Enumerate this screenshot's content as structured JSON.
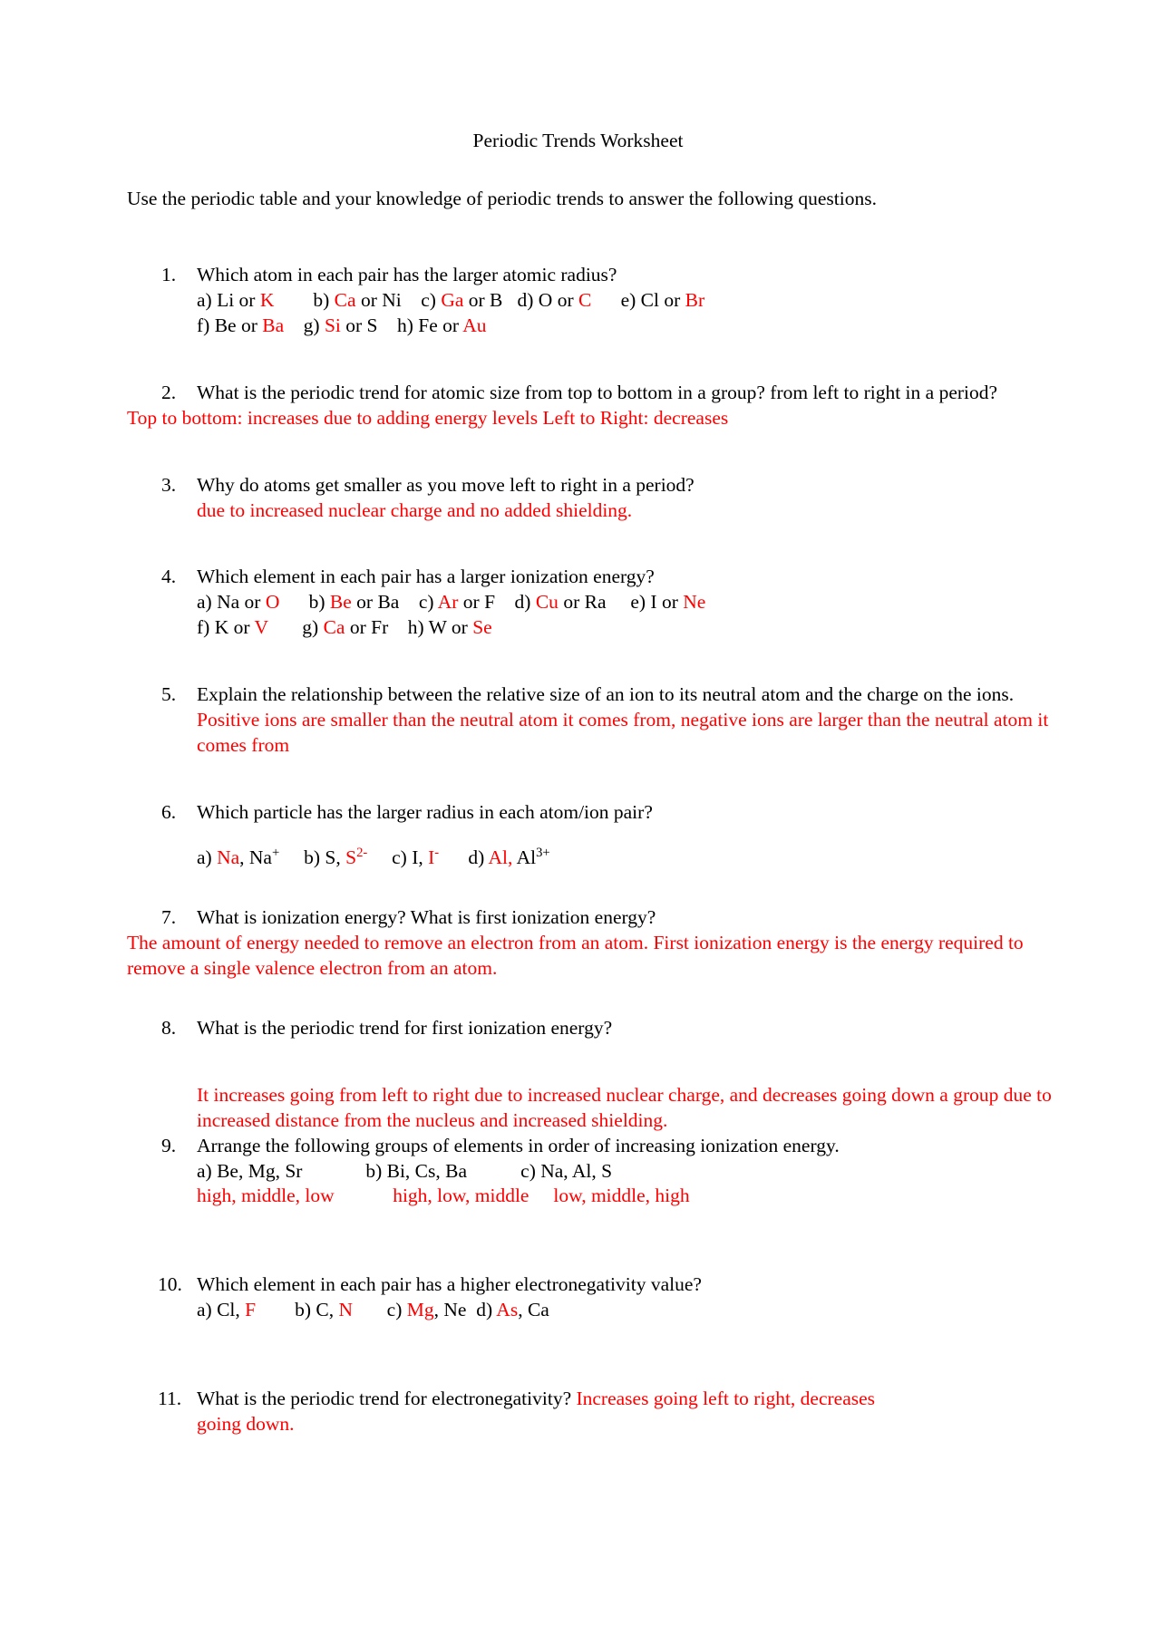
{
  "document": {
    "title": "Periodic Trends Worksheet",
    "intro": "Use the periodic table and your knowledge of periodic trends to answer the following questions."
  },
  "questions": [
    {
      "number": "1.",
      "text": "Which atom in each pair has the larger atomic radius?",
      "options_line_1": {
        "a_label": "a) Li or ",
        "a_answer": "K",
        "b_label": "b) ",
        "b_answer": "Ca",
        "b_rest": " or Ni",
        "c_label": "c) ",
        "c_answer": "Ga",
        "c_rest": " or B",
        "d_label": "d) O or ",
        "d_answer": "C",
        "e_label": "e) Cl or ",
        "e_answer": "Br"
      },
      "options_line_2": {
        "f_label": "f) Be or ",
        "f_answer": "Ba",
        "g_label": "g) ",
        "g_answer": "Si",
        "g_rest": " or S",
        "h_label": "h) Fe or ",
        "h_answer": "Au"
      }
    },
    {
      "number": "2.",
      "text": "What is the periodic trend for atomic size from top to bottom in a group? from left to right in a period?",
      "answer": "Top to bottom: increases due to adding energy levels   Left to Right: decreases"
    },
    {
      "number": "3.",
      "text": "Why do atoms get smaller as you move left to right in a period?",
      "answer": "due to increased nuclear charge and no added shielding."
    },
    {
      "number": "4.",
      "text": "Which element in each pair has a larger ionization energy?",
      "options_line_1": {
        "a_label": "a) Na or ",
        "a_answer": "O",
        "b_label": "b) ",
        "b_answer": "Be",
        "b_rest": " or Ba",
        "c_label": "c) ",
        "c_answer": "Ar",
        "c_rest": " or F",
        "d_label": "d) ",
        "d_answer": "Cu",
        "d_rest": " or Ra",
        "e_label": "e) I or ",
        "e_answer": "Ne"
      },
      "options_line_2": {
        "f_label": "f) K or ",
        "f_answer": "V",
        "g_label": "g) ",
        "g_answer": "Ca",
        "g_rest": " or Fr",
        "h_label": "h) W or ",
        "h_answer": "Se"
      }
    },
    {
      "number": "5.",
      "text": "Explain the relationship between the relative size of an ion to its neutral atom and the charge on the ions.",
      "answer": "Positive ions are smaller than the neutral atom it comes from, negative ions are larger than the neutral atom it comes from"
    },
    {
      "number": "6.",
      "text": "Which particle has the larger radius in each atom/ion pair?",
      "ion_pairs": {
        "a_label": "a) ",
        "a_answer": "Na",
        "a_rest": ", Na",
        "a_sup": "+",
        "b_label": "b) S, ",
        "b_answer": "S",
        "b_sup": "2-",
        "c_label": "c) I, ",
        "c_answer": "I",
        "c_sup": "-",
        "d_label": "d) ",
        "d_answer": "Al,",
        "d_rest": " Al",
        "d_sup": "3+"
      }
    },
    {
      "number": "7.",
      "text": "What is ionization energy? What is first ionization energy?",
      "answer": "The amount of energy needed to remove an electron from an atom. First ionization energy is the energy required to remove a single valence electron from an atom."
    },
    {
      "number": "8.",
      "text": "What is the periodic trend for first ionization energy?",
      "answer": "It increases going from left to right due to increased nuclear charge, and decreases going down a group due to increased distance from the nucleus and increased shielding."
    },
    {
      "number": "9.",
      "text": "Arrange the following groups of elements in order of increasing ionization energy.",
      "groups": {
        "a_label": "a) Be, Mg, Sr",
        "b_label": "b) Bi, Cs, Ba",
        "c_label": "c) Na, Al, S"
      },
      "group_answers": {
        "a_answer": "high, middle, low",
        "b_answer": "high, low, middle",
        "c_answer": "low, middle, high"
      }
    },
    {
      "number": "10.",
      "text": "Which element in each pair has a higher electronegativity value?",
      "options_line_1": {
        "a_label": "a) Cl, ",
        "a_answer": "F",
        "b_label": "b) C, ",
        "b_answer": "N",
        "c_label": "c) ",
        "c_answer": "Mg",
        "c_rest": ", Ne",
        "d_label": "d) ",
        "d_answer": "As",
        "d_rest": ", Ca"
      }
    },
    {
      "number": "11.",
      "text": "What is the periodic trend for electronegativity? ",
      "answer_inline": "Increases going left to right, decreases",
      "answer_line2": "going down."
    }
  ],
  "colors": {
    "answer_red": "#ff0000",
    "text_black": "#000000",
    "page_background": "#ffffff"
  }
}
